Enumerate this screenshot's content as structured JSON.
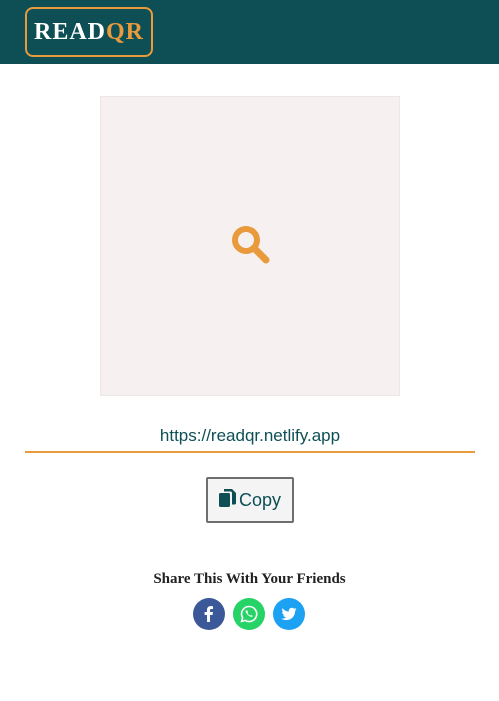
{
  "brand": {
    "logo_read": "READ",
    "logo_qr": "QR"
  },
  "preview": {
    "icon": "search-icon"
  },
  "url_field": {
    "value": "https://readqr.netlify.app"
  },
  "copy_button": {
    "label": "Copy",
    "icon": "copy-icon"
  },
  "share": {
    "title": "Share This With Your Friends",
    "icons": [
      "facebook-icon",
      "whatsapp-icon",
      "twitter-icon"
    ]
  },
  "colors": {
    "navbar": "#0d4f54",
    "accent": "#e89a3c",
    "facebook": "#3b5998",
    "whatsapp": "#25d366",
    "twitter": "#1da1f2"
  }
}
